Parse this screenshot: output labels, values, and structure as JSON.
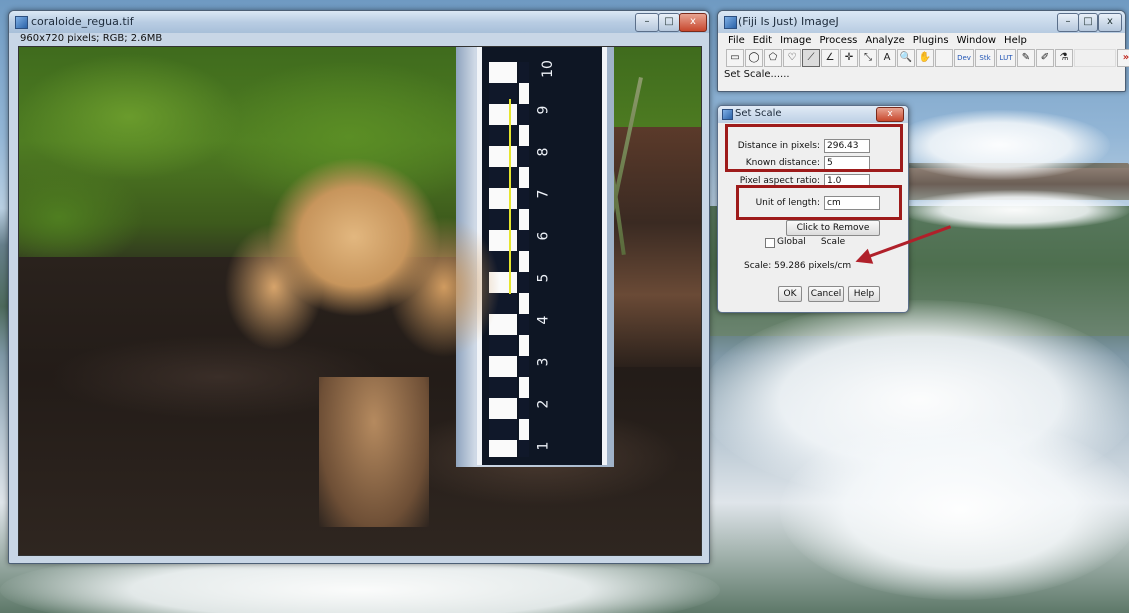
{
  "image_window": {
    "title": "coraloide_regua.tif",
    "info": "960x720 pixels; RGB; 2.6MB",
    "minimize_label": "–",
    "maximize_label": "□",
    "close_label": "x",
    "ruler_numbers": [
      "10",
      "9",
      "8",
      "7",
      "6",
      "5",
      "4",
      "3",
      "2",
      "1"
    ]
  },
  "fiji_window": {
    "title": "(Fiji Is Just) ImageJ",
    "menu": [
      "File",
      "Edit",
      "Image",
      "Process",
      "Analyze",
      "Plugins",
      "Window",
      "Help"
    ],
    "tools": [
      {
        "icon": "rectangle-icon",
        "glyph": "▭"
      },
      {
        "icon": "oval-icon",
        "glyph": "◯"
      },
      {
        "icon": "polygon-icon",
        "glyph": "⬠"
      },
      {
        "icon": "freehand-icon",
        "glyph": "♡"
      },
      {
        "icon": "line-icon",
        "glyph": "⟋"
      },
      {
        "icon": "angle-icon",
        "glyph": "∠"
      },
      {
        "icon": "point-icon",
        "glyph": "✛"
      },
      {
        "icon": "wand-icon",
        "glyph": "⤡"
      },
      {
        "icon": "text-icon",
        "glyph": "A"
      },
      {
        "icon": "magnifier-icon",
        "glyph": "🔍"
      },
      {
        "icon": "hand-icon",
        "glyph": "✋"
      },
      {
        "icon": "blank-tool",
        "glyph": ""
      },
      {
        "icon": "dev-icon",
        "glyph": "Dev"
      },
      {
        "icon": "stk-icon",
        "glyph": "Stk"
      },
      {
        "icon": "lut-icon",
        "glyph": "LUT"
      },
      {
        "icon": "pencil-icon",
        "glyph": "✎"
      },
      {
        "icon": "brush-icon",
        "glyph": "✐"
      },
      {
        "icon": "dropper-icon",
        "glyph": "⚗"
      },
      {
        "icon": "more-tools-icon",
        "glyph": "»"
      }
    ],
    "status": "Set Scale......"
  },
  "dialog": {
    "title": "Set Scale",
    "close_label": "x",
    "distance_label": "Distance in pixels:",
    "distance_value": "296.43",
    "known_label": "Known distance:",
    "known_value": "5",
    "aspect_label": "Pixel aspect ratio:",
    "aspect_value": "1.0",
    "unit_label": "Unit of length:",
    "unit_value": "cm",
    "remove_button": "Click to Remove Scale",
    "global_label": "Global",
    "global_checked": false,
    "scale_text": "Scale: 59.286 pixels/cm",
    "ok": "OK",
    "cancel": "Cancel",
    "help": "Help"
  },
  "colors": {
    "highlight": "#9e1b1b",
    "arrow": "#b0202a"
  }
}
